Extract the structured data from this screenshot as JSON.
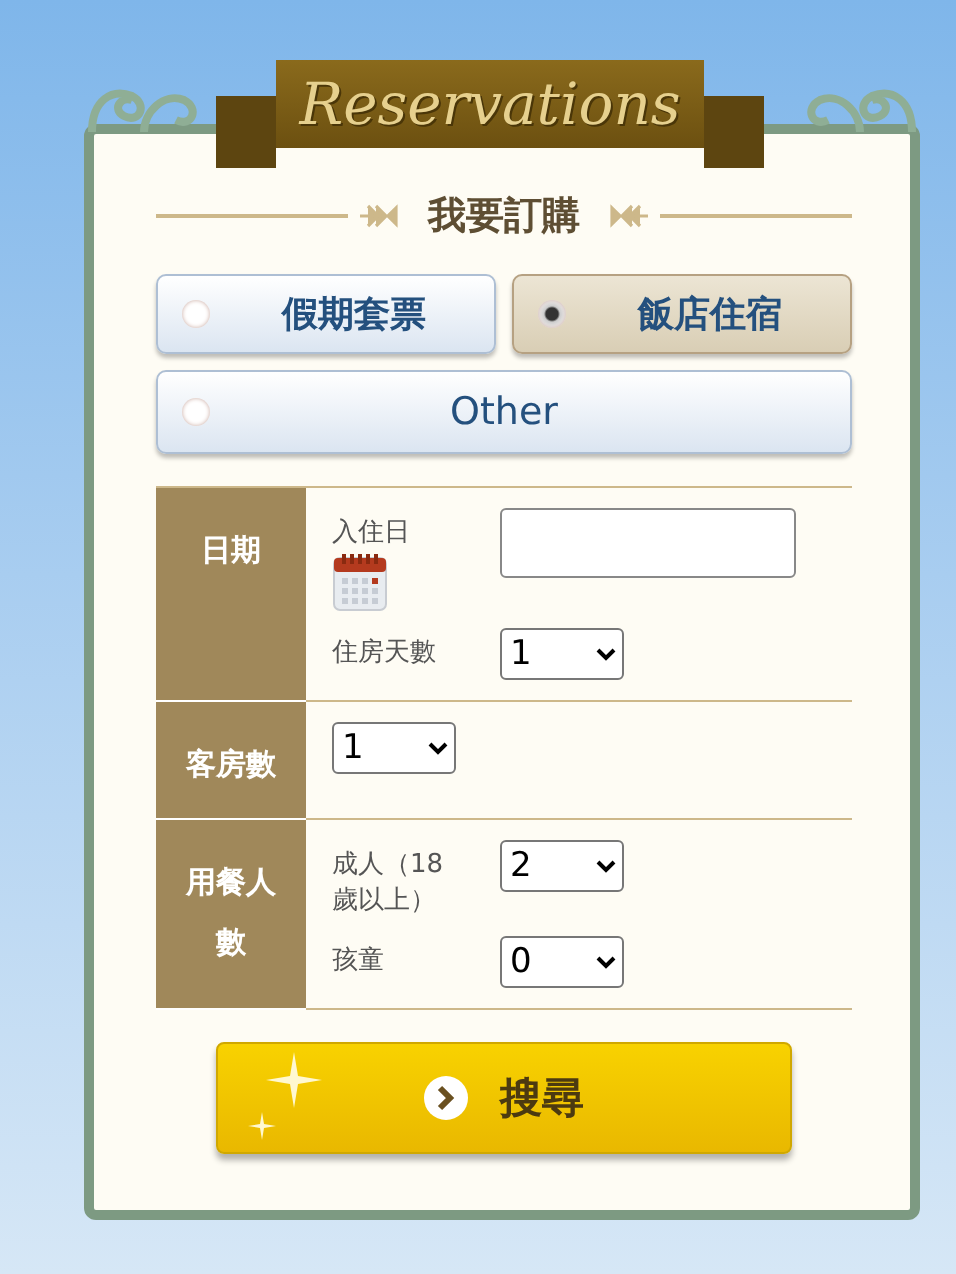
{
  "banner": {
    "title": "Reservations"
  },
  "heading": "我要訂購",
  "options": [
    {
      "label": "假期套票",
      "selected": false
    },
    {
      "label": "飯店住宿",
      "selected": true
    },
    {
      "label": "Other",
      "selected": false
    }
  ],
  "form": {
    "rows": [
      {
        "label": "日期",
        "fields": [
          {
            "kind": "date",
            "label": "入住日"
          },
          {
            "kind": "select",
            "label": "住房天數",
            "value": "1"
          }
        ]
      },
      {
        "label": "客房數",
        "fields": [
          {
            "kind": "select",
            "value": "1"
          }
        ]
      },
      {
        "label": "用餐人數",
        "fields": [
          {
            "kind": "select",
            "label": "成人（18歲以上）",
            "value": "2"
          },
          {
            "kind": "select",
            "label": "孩童",
            "value": "0"
          }
        ]
      }
    ]
  },
  "search_button": "搜尋"
}
